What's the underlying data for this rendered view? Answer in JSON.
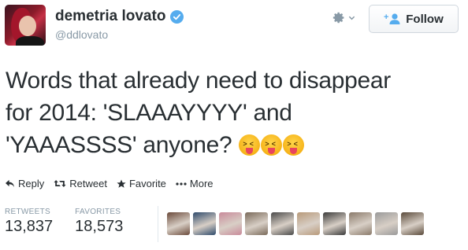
{
  "user": {
    "display_name": "demetria lovato",
    "handle": "@ddlovato"
  },
  "header": {
    "follow_label": "Follow"
  },
  "tweet": {
    "text_parts": {
      "line1": "Words that already need to disappear",
      "line2": "for 2014: 'SLAAAYYYY' and",
      "line3": "'YAAASSSS' anyone?"
    },
    "emoji": [
      "face-with-tongue-and-squinting-eyes",
      "face-with-tongue-and-squinting-eyes",
      "face-with-tongue-and-squinting-eyes"
    ]
  },
  "actions": {
    "reply": "Reply",
    "retweet": "Retweet",
    "favorite": "Favorite",
    "more": "More"
  },
  "stats": {
    "retweets_label": "RETWEETS",
    "retweets_value": "13,837",
    "favorites_label": "FAVORITES",
    "favorites_value": "18,573"
  },
  "favoriters": [
    {
      "color": "#6b4a3a"
    },
    {
      "color": "#2e4a6b"
    },
    {
      "color": "#c98a9a"
    },
    {
      "color": "#7a6a5a"
    },
    {
      "color": "#4a4a4a"
    },
    {
      "color": "#b89a7a"
    },
    {
      "color": "#3a3a3a"
    },
    {
      "color": "#8a7a6a"
    },
    {
      "color": "#9a9a9a"
    },
    {
      "color": "#5a4a3a"
    }
  ],
  "colors": {
    "accent": "#55acee",
    "muted": "#8899a6",
    "text": "#292f33"
  }
}
